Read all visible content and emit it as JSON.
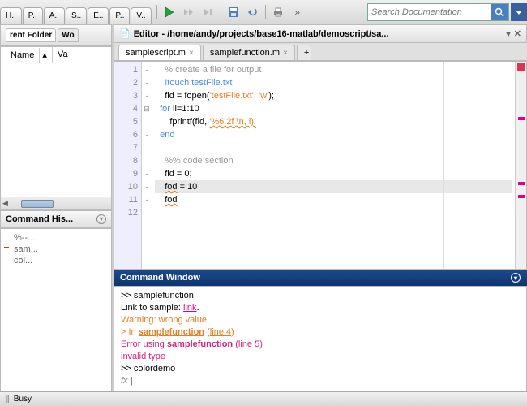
{
  "topbar": {
    "quicktabs": [
      "H..",
      "P..",
      "A..",
      "S..",
      "E..",
      "P..",
      "V.."
    ],
    "search_placeholder": "Search Documentation"
  },
  "folder_panel": {
    "title": "rent Folder",
    "extra_tab": "Wo",
    "col_name": "Name",
    "col_val": "Va"
  },
  "cmd_history": {
    "title": "Command His...",
    "items": [
      {
        "text": "%--...",
        "mark": false
      },
      {
        "text": "sam...",
        "mark": true
      },
      {
        "text": "col...",
        "mark": false
      }
    ]
  },
  "editor": {
    "title": "Editor - /home/andy/projects/base16-matlab/demoscript/sa...",
    "tabs": [
      {
        "label": "samplescript.m",
        "active": true
      },
      {
        "label": "samplefunction.m",
        "active": false
      }
    ],
    "lines": [
      {
        "n": 1,
        "fold": "-",
        "html": "    <span class='comment'>% create a file for output</span>"
      },
      {
        "n": 2,
        "fold": "-",
        "html": "    <span class='cmd'>!touch testFile.txt</span>"
      },
      {
        "n": 3,
        "fold": "-",
        "html": "    fid = fopen(<span class='str'>'testFile.txt'</span>, <span class='str'>'w'</span>);"
      },
      {
        "n": 4,
        "fold": "⊟",
        "html": "  <span class='kw'>for</span> ii=1:10"
      },
      {
        "n": 5,
        "fold": "",
        "html": "      fprintf(fid, <span class='str warn'>'%6.2f \\n, i);</span>"
      },
      {
        "n": 6,
        "fold": "-",
        "html": "  <span class='kw'>end</span>"
      },
      {
        "n": 7,
        "fold": "",
        "html": ""
      },
      {
        "n": 8,
        "fold": "",
        "html": "    <span class='comment'>%% code section</span>"
      },
      {
        "n": 9,
        "fold": "-",
        "html": "    fid = 0;"
      },
      {
        "n": 10,
        "fold": "-",
        "hl": true,
        "html": "    <span class='warn'>fod</span> = 10"
      },
      {
        "n": 11,
        "fold": "-",
        "html": "    <span class='warn'>fod</span>"
      },
      {
        "n": 12,
        "fold": "",
        "html": ""
      }
    ]
  },
  "cmdwin": {
    "title": "Command Window",
    "rows": [
      {
        "html": ">> samplefunction"
      },
      {
        "html": "Link to sample: <span class='link'>link</span>."
      },
      {
        "html": "<span class='warntxt'>Warning: wrong value</span>"
      },
      {
        "html": "<span class='warntxt'>> In <b><u>samplefunction</u></b> (<u>line 4</u>)</span>"
      },
      {
        "html": "<span class='errtxt'>Error using <b><u>samplefunction</u></b> (<u>line 5</u>)</span>"
      },
      {
        "html": "<span class='errtxt'>invalid type</span>"
      },
      {
        "html": ">> colordemo"
      },
      {
        "html": "<span class='fx'>fx</span> |"
      }
    ]
  },
  "status": {
    "text": "Busy"
  }
}
